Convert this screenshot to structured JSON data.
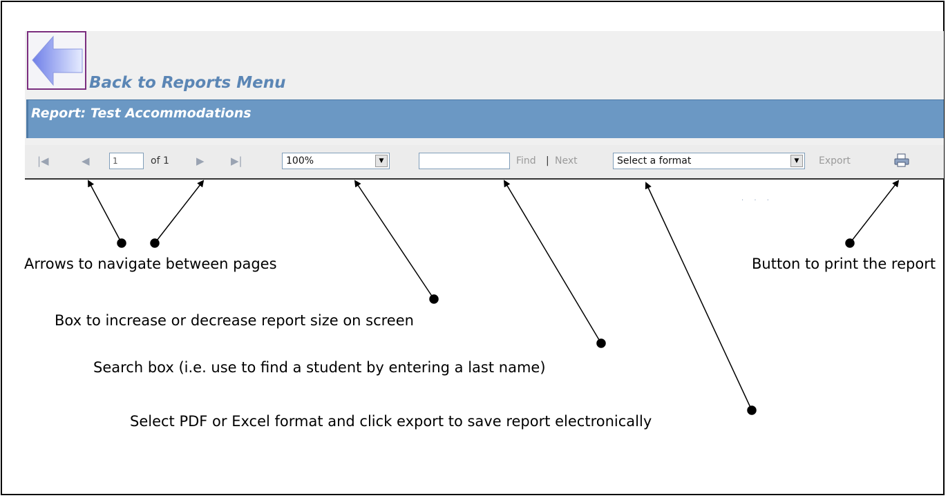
{
  "back_link": {
    "label": "Back to Reports Menu"
  },
  "report": {
    "title": "Report: Test Accommodations"
  },
  "toolbar": {
    "first_page_icon": "first-page-icon",
    "prev_page_icon": "previous-page-icon",
    "page_value": "1",
    "of_label": "of 1",
    "next_page_icon": "next-page-icon",
    "last_page_icon": "last-page-icon",
    "zoom_value": "100%",
    "find_value": "",
    "find_label": "Find",
    "separator": "|",
    "next_label": "Next",
    "format_value": "Select a format",
    "export_label": "Export",
    "print_icon": "printer-icon"
  },
  "annotations": {
    "navigate": "Arrows to navigate between pages",
    "zoom": "Box to increase or decrease report size on screen",
    "search": "Search box (i.e. use to find a student by entering a last name)",
    "export": "Select PDF or Excel format and click export to save report electronically",
    "print": "Button to print the report"
  },
  "colors": {
    "report_bar": "#6b98c4",
    "back_label": "#5b86b5",
    "frame_border": "#7a2d7e"
  }
}
